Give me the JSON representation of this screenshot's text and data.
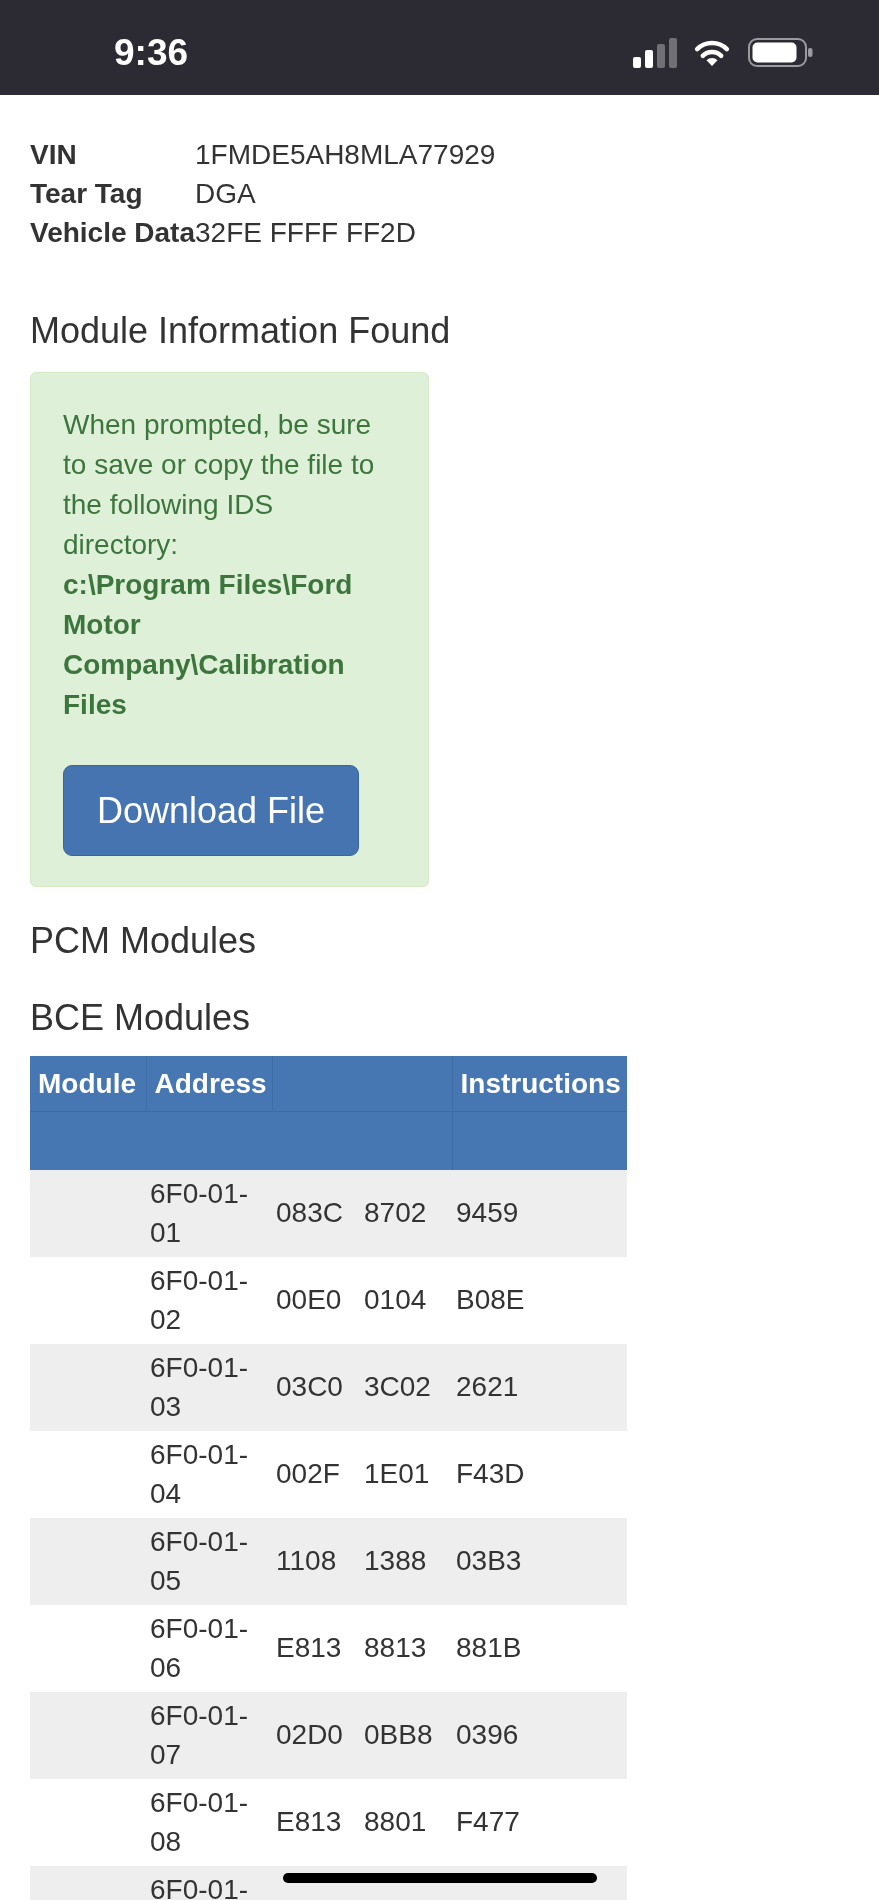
{
  "status_bar": {
    "time": "9:36"
  },
  "vehicle": [
    {
      "label": "VIN",
      "value": "1FMDE5AH8MLA77929"
    },
    {
      "label": "Tear Tag",
      "value": "DGA"
    },
    {
      "label": "Vehicle Data",
      "value": "32FE FFFF FF2D"
    }
  ],
  "module_info": {
    "heading": "Module Information Found",
    "message": "When prompted, be sure to save or copy the file to the following IDS directory:",
    "path": "c:\\Program Files\\Ford Motor Company\\Calibration Files",
    "button": "Download File"
  },
  "pcm_modules": {
    "heading": "PCM Modules"
  },
  "bce_modules": {
    "heading": "BCE Modules",
    "table": {
      "header": {
        "module": "Module",
        "address": "Address",
        "instructions": "Instructions"
      },
      "rows": [
        {
          "address": "6F0-01-01",
          "column_3": "083C",
          "column_4": "8702",
          "instructions": "9459"
        },
        {
          "address": "6F0-01-02",
          "column_3": "00E0",
          "column_4": "0104",
          "instructions": "B08E"
        },
        {
          "address": "6F0-01-03",
          "column_3": "03C0",
          "column_4": "3C02",
          "instructions": "2621"
        },
        {
          "address": "6F0-01-04",
          "column_3": "002F",
          "column_4": "1E01",
          "instructions": "F43D"
        },
        {
          "address": "6F0-01-05",
          "column_3": "1108",
          "column_4": "1388",
          "instructions": "03B3"
        },
        {
          "address": "6F0-01-06",
          "column_3": "E813",
          "column_4": "8813",
          "instructions": "881B"
        },
        {
          "address": "6F0-01-07",
          "column_3": "02D0",
          "column_4": "0BB8",
          "instructions": "0396"
        },
        {
          "address": "6F0-01-08",
          "column_3": "E813",
          "column_4": "8801",
          "instructions": "F477"
        },
        {
          "address": "6F0-01-"
        }
      ]
    }
  }
}
